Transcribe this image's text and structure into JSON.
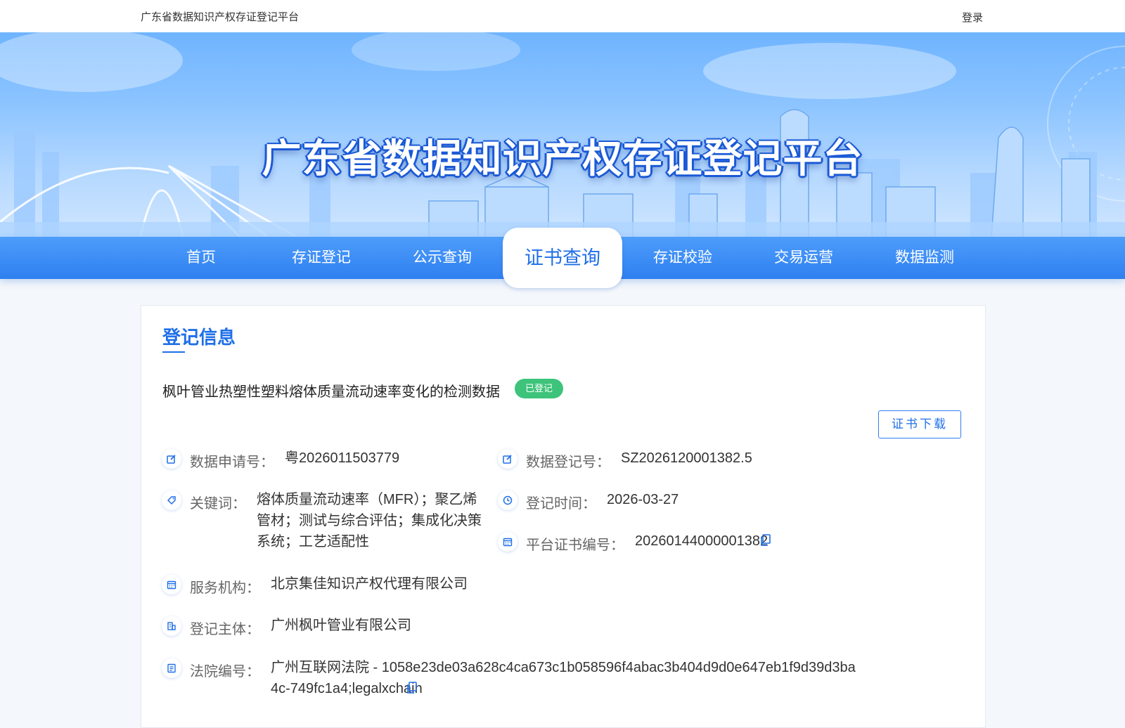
{
  "header": {
    "brand": "广东省数据知识产权存证登记平台",
    "login_label": "登录"
  },
  "banner": {
    "title": "广东省数据知识产权存证登记平台"
  },
  "nav": {
    "items": [
      "首页",
      "存证登记",
      "公示查询",
      "证书查询",
      "存证校验",
      "交易运营",
      "数据监测"
    ],
    "active": "证书查询"
  },
  "record": {
    "section_title": "登记信息",
    "title": "枫叶管业热塑性塑料熔体质量流动速率变化的检测数据",
    "status": "已登记",
    "download_label": "证书下载",
    "fields": {
      "application_no": {
        "label": "数据申请号：",
        "value": "粤2026011503779"
      },
      "registration_no": {
        "label": "数据登记号：",
        "value": "SZ2026120001382.5"
      },
      "keywords": {
        "label": "关键词：",
        "value": "熔体质量流动速率（MFR）；聚乙烯管材；测试与综合评估；集成化决策系统；工艺适配性"
      },
      "registration_time": {
        "label": "登记时间：",
        "value": "2026-03-27"
      },
      "certificate_no": {
        "label": "平台证书编号：",
        "value": "20260144000001382"
      },
      "service_org": {
        "label": "服务机构：",
        "value": "北京集佳知识产权代理有限公司"
      },
      "registrant": {
        "label": "登记主体：",
        "value": "广州枫叶管业有限公司"
      },
      "court_no": {
        "label": "法院编号：",
        "value": "广州互联网法院 - 1058e23de03a628c4ca673c1b058596f4abac3b404d9d0e647eb1f9d39d3ba4c-749fc1a4;legalxchain"
      }
    }
  },
  "colors": {
    "primary": "#1f6fe8",
    "nav_bg": "#3a8af5",
    "status_green": "#3dc37a"
  }
}
